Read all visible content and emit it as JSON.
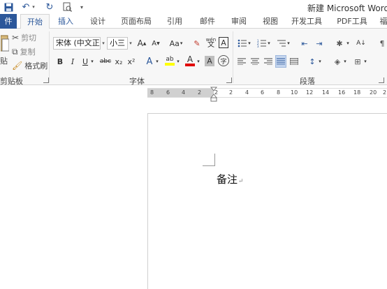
{
  "window": {
    "title": "新建 Microsoft Word 文"
  },
  "tabs": [
    "件",
    "开始",
    "插入",
    "设计",
    "页面布局",
    "引用",
    "邮件",
    "审阅",
    "视图",
    "开发工具",
    "PDF工具",
    "福"
  ],
  "clipboard": {
    "cut_label": "剪切",
    "copy_label": "复制",
    "format_painter_label": "格式刷",
    "paste_label": "贴",
    "group_label": "剪贴板"
  },
  "font": {
    "font_name": "宋体 (中文正文",
    "font_size": "小三",
    "grow": "A",
    "shrink": "A",
    "case": "Aa",
    "bold": "B",
    "italic": "I",
    "underline": "U",
    "strikethrough": "abc",
    "subscript": "x₂",
    "superscript": "x²",
    "text_effect": "A",
    "highlight": "ab",
    "font_color": "A",
    "char_shading": "A",
    "pinyin": "wén",
    "border_char": "A",
    "enclose": "字",
    "group_label": "字体"
  },
  "paragraph": {
    "sort": "A↓",
    "group_label": "段落"
  },
  "ruler": {
    "numbers": [
      "8",
      "6",
      "4",
      "2",
      "2",
      "2",
      "4",
      "6",
      "8",
      "10",
      "12",
      "14",
      "16",
      "18",
      "20",
      "2"
    ]
  },
  "document": {
    "text": "备注",
    "para_mark": "↵"
  },
  "colors": {
    "accent": "#2b579a",
    "highlight_yellow": "#ffff00",
    "font_red": "#e00000"
  }
}
